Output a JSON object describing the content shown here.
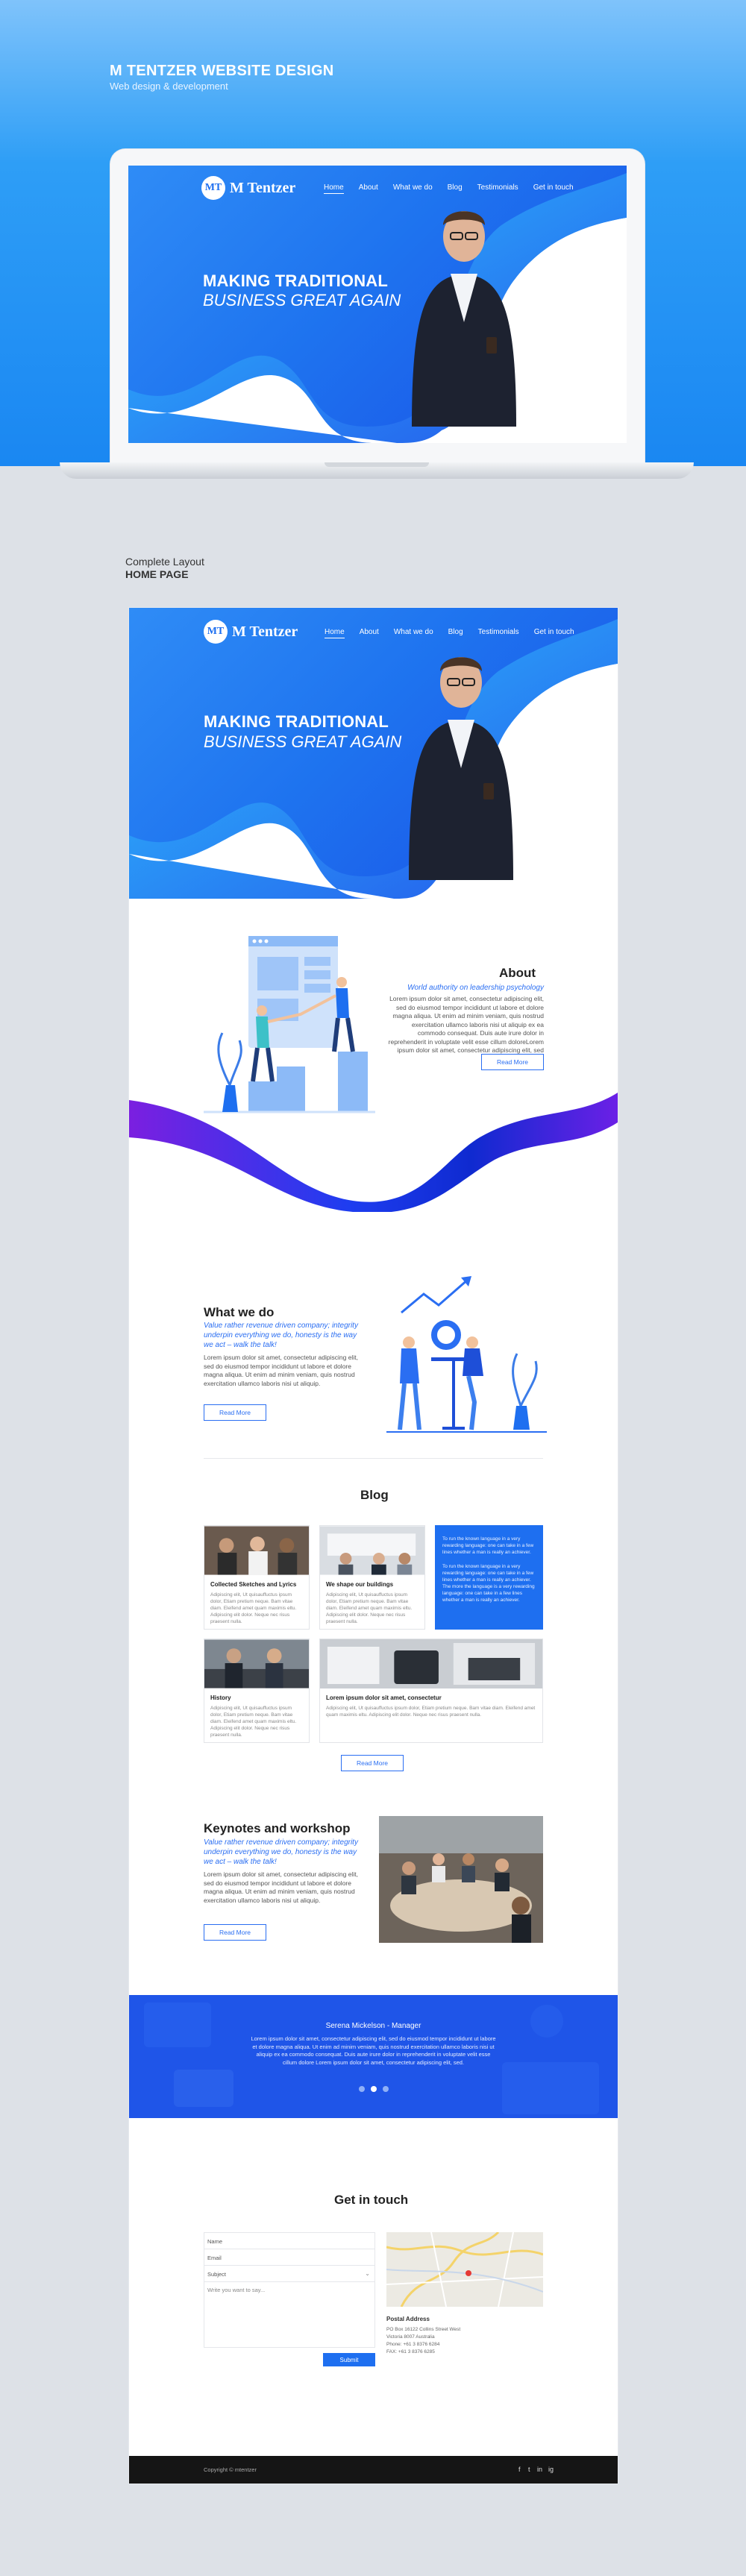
{
  "banner": {
    "title": "M TENTZER WEBSITE DESIGN",
    "subtitle": "Web design & development"
  },
  "site": {
    "logo_mark": "MT",
    "logo_text": "M Tentzer",
    "nav": [
      "Home",
      "About",
      "What we do",
      "Blog",
      "Testimonials",
      "Get in touch"
    ],
    "hero_line1": "MAKING TRADITIONAL",
    "hero_line2": "BUSINESS GREAT AGAIN"
  },
  "layout_label": {
    "line1": "Complete  Layout",
    "line2": "HOME PAGE"
  },
  "about": {
    "title": "About",
    "subtitle": "World authority on leadership psychology",
    "body": "Lorem ipsum dolor sit amet, consectetur adipiscing elit, sed do eiusmod tempor incididunt ut labore et dolore magna aliqua. Ut enim ad minim veniam, quis nostrud exercitation ullamco laboris nisi ut aliquip ex ea commodo consequat. Duis aute irure dolor in reprehenderit in voluptate velit esse cillum doloreLorem ipsum dolor sit amet, consectetur adipiscing elit, sed",
    "button": "Read More"
  },
  "whatwedo": {
    "title": "What we do",
    "subtitle": "Value rather revenue driven company; integrity underpin everything we do, honesty is the way we act – walk the talk!",
    "body": "Lorem ipsum dolor sit amet, consectetur adipiscing elit, sed do eiusmod tempor incididunt ut labore et dolore magna aliqua. Ut enim ad minim veniam, quis nostrud exercitation ullamco laboris nisi ut aliquip.",
    "button": "Read More"
  },
  "blog": {
    "title": "Blog",
    "cards": [
      {
        "title": "Collected Sketches and Lyrics",
        "body": "Adipiscing elit, Ut quisauffuctus ipsum dolor, Etiam pretium neque. Bam vitae diam. Eleifend amet quam maximis eltu. Adipiscing elit dolor. Neque nec risus praesent nulla."
      },
      {
        "title": "We shape our buildings",
        "body": "Adipiscing elit, Ut quisauffuctus ipsum dolor, Etiam pretium neque. Bam vitae diam. Eleifend amet quam maximis eltu. Adipiscing elit dolor. Neque nec risus praesent nulla."
      },
      {
        "title": "History",
        "body": "Adipiscing elit, Ut quisauffuctus ipsum dolor, Etiam pretium neque. Bam vitae diam. Eleifend amet quam maximis eltu. Adipiscing elit dolor. Neque nec risus praesent nulla."
      },
      {
        "title": "Lorem ipsum dolor sit amet, consectetur",
        "body": "Adipiscing elit, Ut quisauffuctus ipsum dolor, Etiam pretium neque. Bam vitae diam. Eleifend amet quam maximis eltu. Adipiscing elit dolor. Neque nec risus praesent nulla."
      }
    ],
    "feature_p1": "To run the known language in a very rewarding language: one can take in a few lines whether a man is really an achiever.",
    "feature_p2": "To run the known language in a very rewarding language: one can take in a few lines whether a man is really an achiever. The more the language is a very rewarding language: one can take in a few lines whether a man is really an achiever.",
    "button": "Read More"
  },
  "keynotes": {
    "title": "Keynotes and workshop",
    "subtitle": "Value rather revenue driven company; integrity underpin everything we do, honesty is the way we act – walk the talk!",
    "body": "Lorem ipsum dolor sit amet, consectetur adipiscing elit, sed do eiusmod tempor incididunt ut labore et dolore magna aliqua. Ut enim ad minim veniam, quis nostrud exercitation ullamco laboris nisi ut aliquip.",
    "button": "Read More"
  },
  "testimonial": {
    "name": "Serena Mickelson - Manager",
    "quote": "Lorem ipsum dolor sit amet, consectetur adipiscing elit, sed do eiusmod tempor incididunt ut labore et dolore magna aliqua. Ut enim ad minim veniam, quis nostrud exercitation ullamco laboris nisi ut aliquip ex ea commodo consequat. Duis aute irure dolor in reprehenderit in voluptate velit esse cillum dolore Lorem ipsum dolor sit amet, consectetur adipiscing elit, sed."
  },
  "contact": {
    "title": "Get in touch",
    "fields": [
      "Name",
      "Email",
      "Subject"
    ],
    "message_placeholder": "Write you want to say...",
    "submit": "Submit",
    "address_title": "Postal Address",
    "address_lines": [
      "PO Box 16122 Collins Street West",
      "Victoria 8007 Australia",
      "Phone: +61 3 8376 6284",
      "FAX: +61 3 8376 6285"
    ]
  },
  "footer": {
    "copyright": "Copyright © mtentzer",
    "social": [
      "f",
      "t",
      "in",
      "ig"
    ]
  },
  "colors": {
    "primary": "#1e6ff0",
    "accent": "#2a6ef2",
    "banner_top": "#7fc3fb",
    "banner_bottom": "#1a87f2",
    "footer": "#151515"
  }
}
